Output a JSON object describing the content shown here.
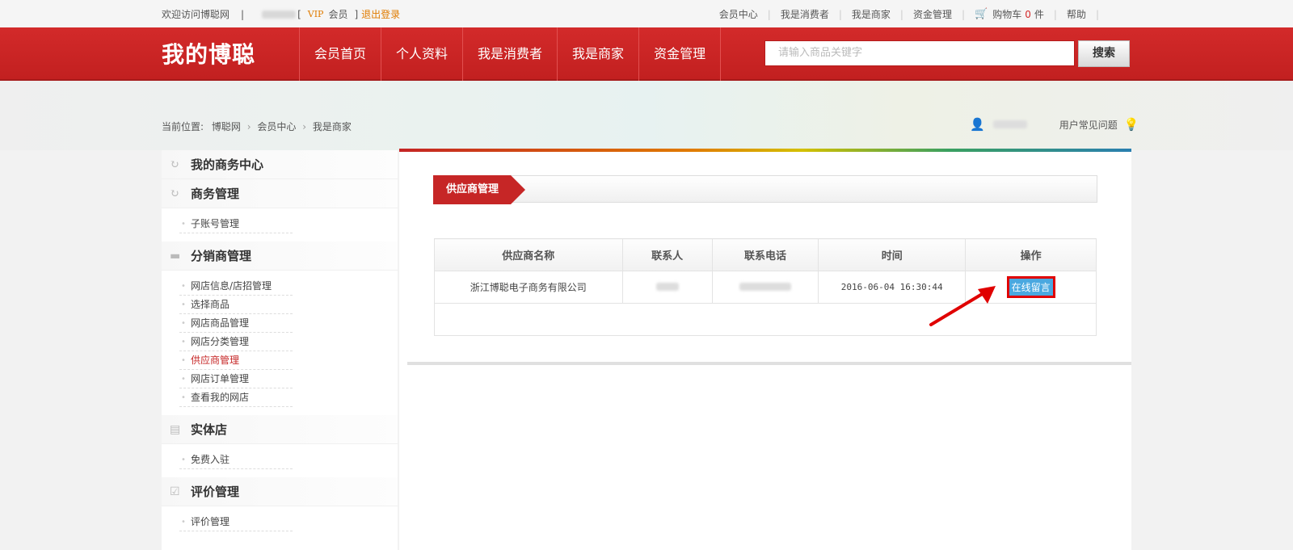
{
  "topbar": {
    "welcome": "欢迎访问博聪网",
    "divider": "|",
    "bracket_open": "[",
    "vip": "VIP",
    "member": "会员",
    "bracket_close": "]",
    "logout": "退出登录",
    "links": [
      "会员中心",
      "我是消费者",
      "我是商家",
      "资金管理"
    ],
    "cart_label": "购物车",
    "cart_count": "0",
    "cart_unit": "件",
    "help": "帮助"
  },
  "header": {
    "logo": "我的博聪",
    "nav": [
      "会员首页",
      "个人资料",
      "我是消费者",
      "我是商家",
      "资金管理"
    ],
    "search_placeholder": "请输入商品关键字",
    "search_button": "搜索"
  },
  "breadcrumb": {
    "prefix": "当前位置:",
    "items": [
      "博聪网",
      "会员中心",
      "我是商家"
    ]
  },
  "user_area": {
    "faq": "用户常见问题"
  },
  "sidebar": {
    "sections": [
      {
        "title": "我的商务中心",
        "items": []
      },
      {
        "title": "商务管理",
        "items": [
          "子账号管理"
        ]
      },
      {
        "title": "分销商管理",
        "items": [
          "网店信息/店招管理",
          "选择商品",
          "网店商品管理",
          "网店分类管理",
          "供应商管理",
          "网店订单管理",
          "查看我的网店"
        ]
      },
      {
        "title": "实体店",
        "items": [
          "免费入驻"
        ]
      },
      {
        "title": "评价管理",
        "items": [
          "评价管理"
        ]
      }
    ],
    "active_item": "供应商管理"
  },
  "main": {
    "tab_label": "供应商管理",
    "table": {
      "headers": [
        "供应商名称",
        "联系人",
        "联系电话",
        "时间",
        "操作"
      ],
      "rows": [
        {
          "name": "浙江博聪电子商务有限公司",
          "time": "2016-06-04 16:30:44",
          "action": "在线留言"
        }
      ]
    }
  }
}
